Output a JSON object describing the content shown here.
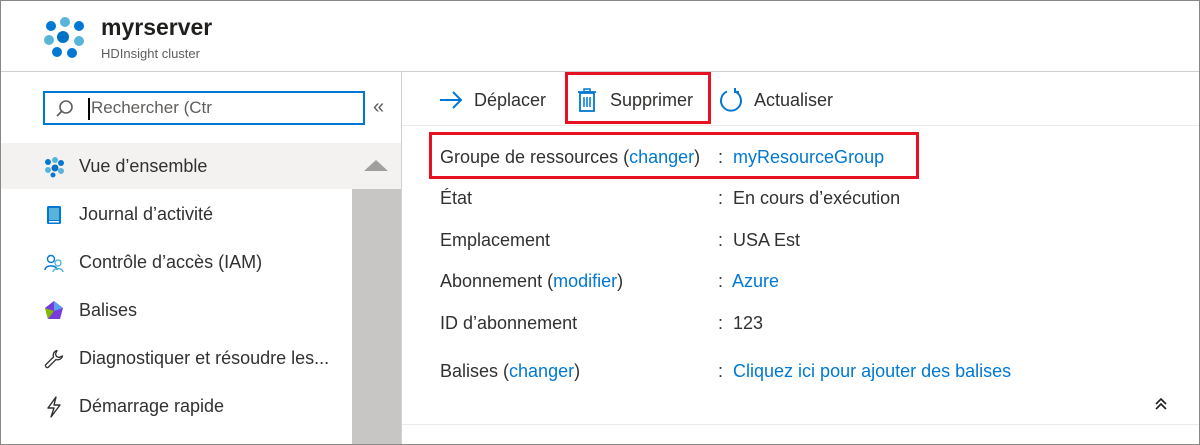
{
  "header": {
    "title": "myrserver",
    "subtitle": "HDInsight cluster",
    "logo_icon": "hdinsight-cluster-icon"
  },
  "search": {
    "placeholder": "Rechercher (Ctr",
    "collapse_label": "«"
  },
  "nav": {
    "items": [
      {
        "label": "Vue d’ensemble",
        "icon": "overview-icon",
        "active": true
      },
      {
        "label": "Journal d’activité",
        "icon": "activity-log-icon"
      },
      {
        "label": "Contrôle d’accès (IAM)",
        "icon": "access-control-icon"
      },
      {
        "label": "Balises",
        "icon": "tag-icon"
      },
      {
        "label": "Diagnostiquer et résoudre les...",
        "icon": "wrench-icon"
      },
      {
        "label": "Démarrage rapide",
        "icon": "lightning-icon"
      }
    ]
  },
  "toolbar": {
    "move_label": "Déplacer",
    "delete_label": "Supprimer",
    "refresh_label": "Actualiser"
  },
  "properties": {
    "resource_group": {
      "label": "Groupe de ressources",
      "change_link": "changer",
      "value": "myResourceGroup"
    },
    "state": {
      "label": "État",
      "value": "En cours d’exécution"
    },
    "location": {
      "label": "Emplacement",
      "value": "USA Est"
    },
    "subscription": {
      "label": "Abonnement",
      "change_link": "modifier",
      "value": "Azure"
    },
    "subscription_id": {
      "label": "ID d’abonnement",
      "value": "123"
    },
    "tags": {
      "label": "Balises",
      "change_link": "changer",
      "value": "Cliquez ici pour ajouter des balises"
    },
    "separator": ":",
    "collapse_label": "⌃"
  },
  "colors": {
    "accent": "#0078d4",
    "highlight_border": "#e81123"
  }
}
